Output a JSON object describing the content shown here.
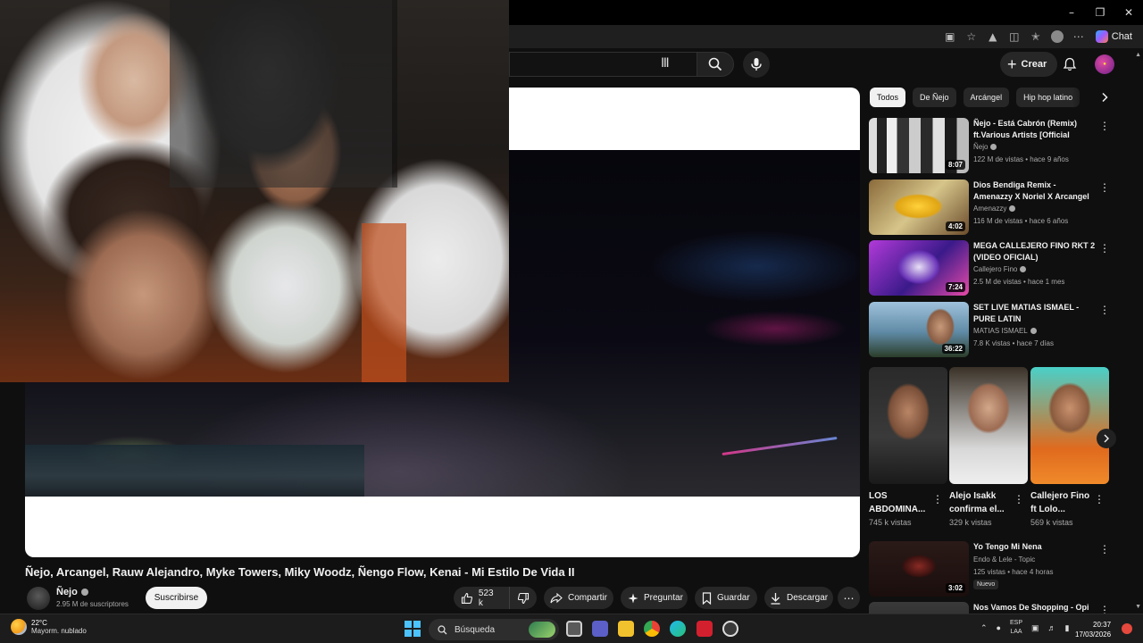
{
  "browser": {
    "chat_label": "Chat",
    "window_controls": [
      "minimize",
      "maximize",
      "close"
    ]
  },
  "youtube_header": {
    "search_value": "",
    "create_label": "Crear"
  },
  "video": {
    "title": "Ñejo, Arcangel, Rauw Alejandro, Myke Towers, Miky Woodz, Ñengo Flow, Kenai - Mi Estilo De Vida II",
    "channel": "Ñejo",
    "subscribers": "2.95 M de suscriptores",
    "subscribe_label": "Suscribirse",
    "likes": "523 k",
    "share_label": "Compartir",
    "ask_label": "Preguntar",
    "save_label": "Guardar",
    "download_label": "Descargar"
  },
  "sidebar": {
    "chips": [
      "Todos",
      "De Ñejo",
      "Arcángel",
      "Hip hop latino"
    ],
    "recommendations": [
      {
        "title": "Ñejo - Está Cabrón (Remix) ft.Various Artists [Official Audio]",
        "channel": "Ñejo",
        "verified": true,
        "meta": "122 M de vistas • hace 9 años",
        "duration": "8:07"
      },
      {
        "title": "Dios Bendiga Remix - Amenazzy X Noriel X Arcangel X De La ...",
        "channel": "Amenazzy",
        "verified": true,
        "meta": "116 M de vistas • hace 6 años",
        "duration": "4:02"
      },
      {
        "title": "MEGA CALLEJERO FINO RKT 2 (VIDEO OFICIAL)",
        "channel": "Callejero Fino",
        "verified": true,
        "meta": "2.5 M de vistas • hace 1 mes",
        "duration": "7:24"
      },
      {
        "title": "SET LIVE MATIAS ISMAEL - PURE LATIN",
        "channel": "MATIAS ISMAEL",
        "verified": true,
        "meta": "7.8 K vistas • hace 7 días",
        "duration": "36:22"
      }
    ],
    "shorts": [
      {
        "title": "LOS ABDOMINA...",
        "views": "745 k vistas"
      },
      {
        "title": "Alejo Isakk confirma el...",
        "views": "329 k vistas"
      },
      {
        "title": "Callejero Fino ft Lolo...",
        "views": "569 k vistas"
      }
    ],
    "more_recommendations": [
      {
        "title": "Yo Tengo Mi Nena",
        "channel": "Endo & Lele - Topic",
        "meta": "125 vistas • hace 4 horas",
        "badge": "Nuevo",
        "duration": "3:02"
      },
      {
        "title": "Nos Vamos De Shopping - Opi",
        "channel": "",
        "meta": "",
        "badge": "",
        "duration": ""
      }
    ]
  },
  "taskbar": {
    "temperature": "22°C",
    "weather": "Mayorm. nublado",
    "search_label": "Búsqueda",
    "lang_top": "ESP",
    "lang_bottom": "LAA",
    "time": "20:37",
    "date": "17/03/2026"
  },
  "colors": {
    "background": "#0f0f0f",
    "pill": "#272727",
    "accent_blue": "#4cc2ff"
  }
}
